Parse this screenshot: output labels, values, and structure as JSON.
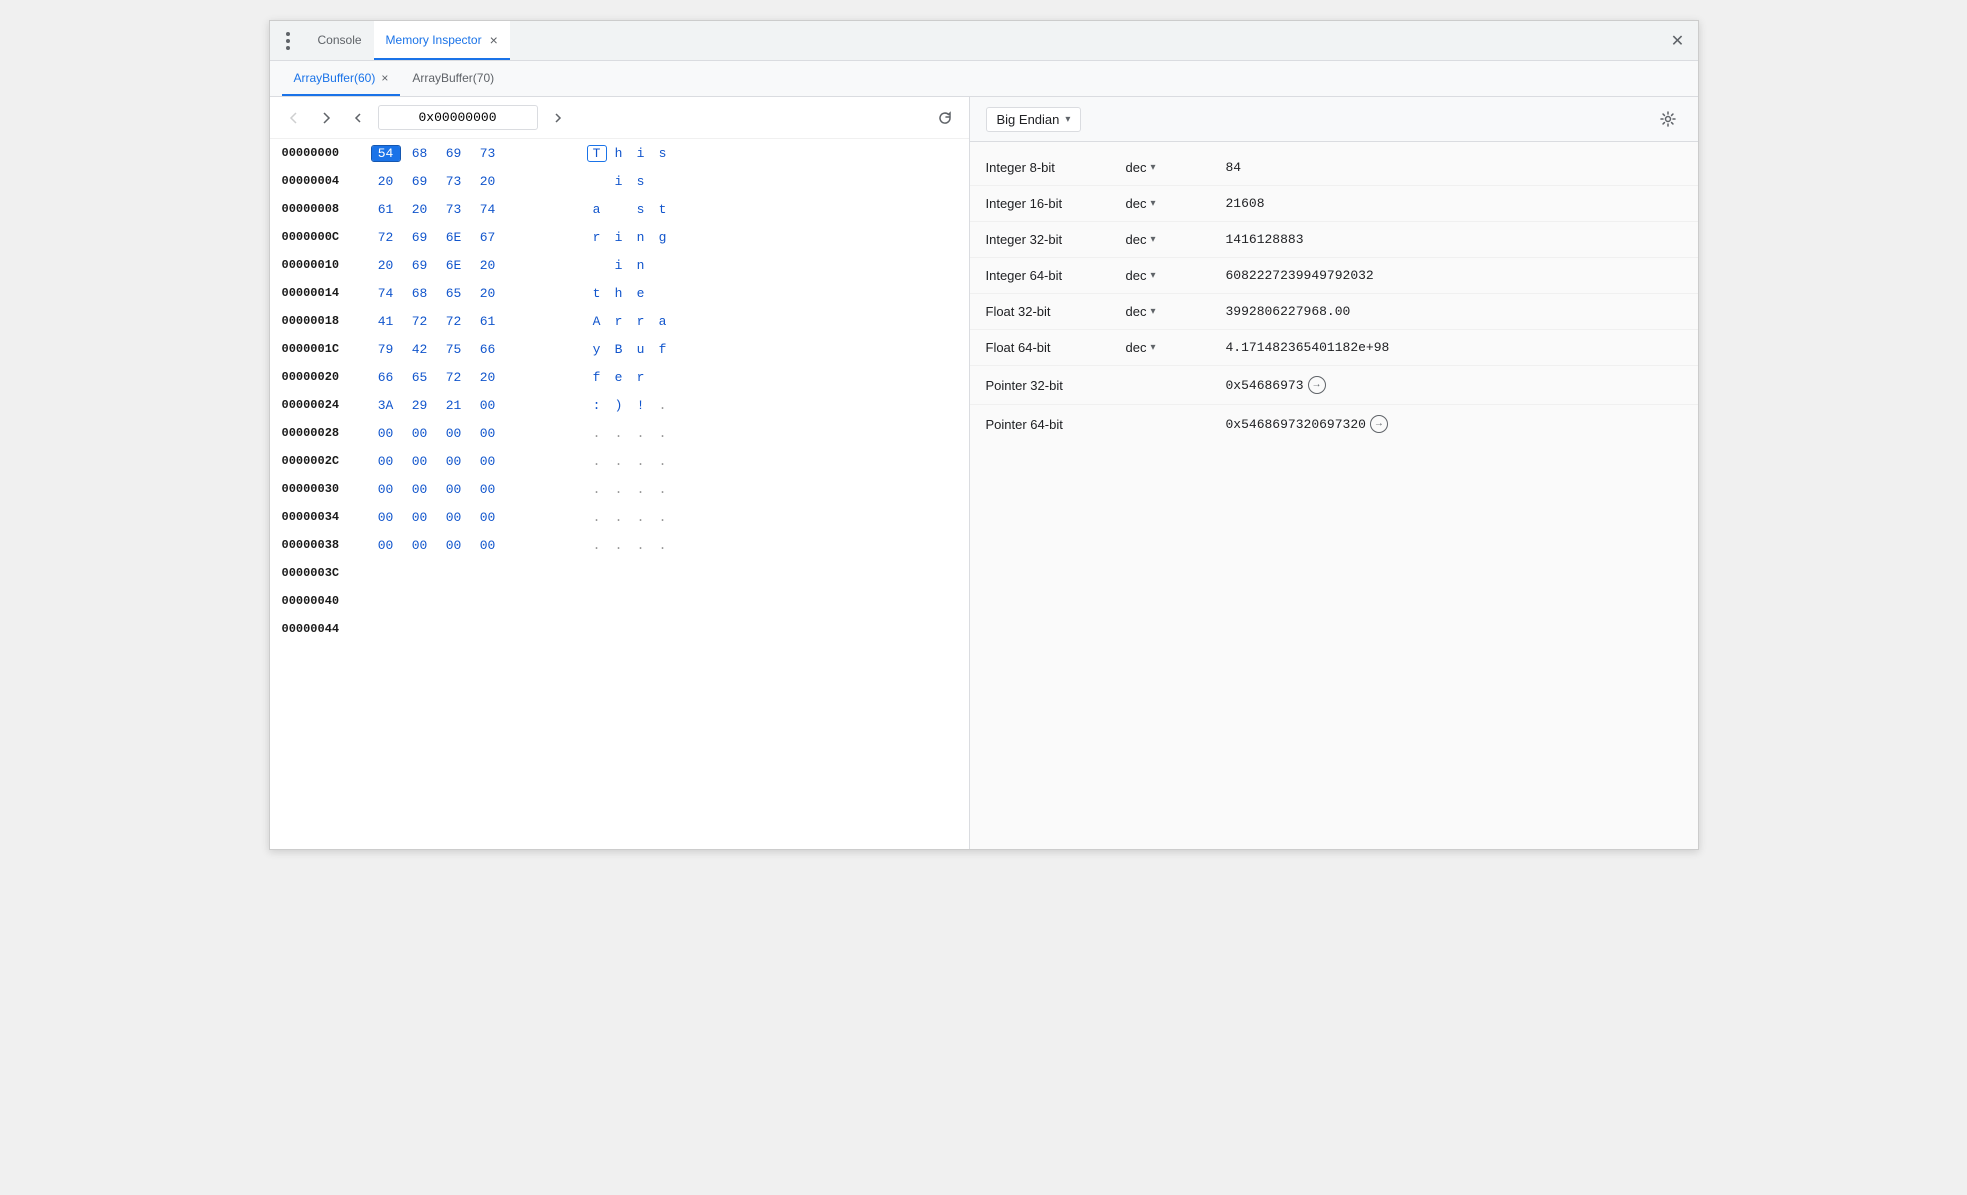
{
  "window": {
    "title": "Memory Inspector",
    "close_label": "✕"
  },
  "top_tabs": [
    {
      "id": "console",
      "label": "Console",
      "active": false,
      "closeable": false
    },
    {
      "id": "memory-inspector",
      "label": "Memory Inspector",
      "active": true,
      "closeable": true
    }
  ],
  "buffer_tabs": [
    {
      "id": "arraybuffer60",
      "label": "ArrayBuffer(60)",
      "active": true,
      "closeable": true
    },
    {
      "id": "arraybuffer70",
      "label": "ArrayBuffer(70)",
      "active": false,
      "closeable": false
    }
  ],
  "nav": {
    "back_label": "‹",
    "forward_label": "›",
    "address": "0x00000000",
    "refresh_label": "↻"
  },
  "memory_rows": [
    {
      "address": "00000000",
      "bytes": [
        "54",
        "68",
        "69",
        "73"
      ],
      "chars": [
        "T",
        "h",
        "i",
        "s"
      ],
      "selected_byte": 0,
      "highlighted_char": 0
    },
    {
      "address": "00000004",
      "bytes": [
        "20",
        "69",
        "73",
        "20"
      ],
      "chars": [
        " ",
        "i",
        "s",
        " "
      ]
    },
    {
      "address": "00000008",
      "bytes": [
        "61",
        "20",
        "73",
        "74"
      ],
      "chars": [
        "a",
        " ",
        "s",
        "t"
      ]
    },
    {
      "address": "0000000C",
      "bytes": [
        "72",
        "69",
        "6E",
        "67"
      ],
      "chars": [
        "r",
        "i",
        "n",
        "g"
      ]
    },
    {
      "address": "00000010",
      "bytes": [
        "20",
        "69",
        "6E",
        "20"
      ],
      "chars": [
        " ",
        "i",
        "n",
        " "
      ]
    },
    {
      "address": "00000014",
      "bytes": [
        "74",
        "68",
        "65",
        "20"
      ],
      "chars": [
        "t",
        "h",
        "e",
        " "
      ]
    },
    {
      "address": "00000018",
      "bytes": [
        "41",
        "72",
        "72",
        "61"
      ],
      "chars": [
        "A",
        "r",
        "r",
        "a"
      ]
    },
    {
      "address": "0000001C",
      "bytes": [
        "79",
        "42",
        "75",
        "66"
      ],
      "chars": [
        "y",
        "B",
        "u",
        "f"
      ]
    },
    {
      "address": "00000020",
      "bytes": [
        "66",
        "65",
        "72",
        "20"
      ],
      "chars": [
        "f",
        "e",
        "r",
        " "
      ]
    },
    {
      "address": "00000024",
      "bytes": [
        "3A",
        "29",
        "21",
        "00"
      ],
      "chars": [
        ":",
        ")",
        " ",
        "!"
      ]
    },
    {
      "address": "00000028",
      "bytes": [
        "00",
        "00",
        "00",
        "00"
      ],
      "chars": [
        ".",
        ".",
        ".",
        "."
      ]
    },
    {
      "address": "0000002C",
      "bytes": [
        "00",
        "00",
        "00",
        "00"
      ],
      "chars": [
        ".",
        ".",
        ".",
        "."
      ]
    },
    {
      "address": "00000030",
      "bytes": [
        "00",
        "00",
        "00",
        "00"
      ],
      "chars": [
        ".",
        ".",
        ".",
        "."
      ]
    },
    {
      "address": "00000034",
      "bytes": [
        "00",
        "00",
        "00",
        "00"
      ],
      "chars": [
        ".",
        ".",
        ".",
        "."
      ]
    },
    {
      "address": "00000038",
      "bytes": [
        "00",
        "00",
        "00",
        "00"
      ],
      "chars": [
        ".",
        ".",
        ".",
        "."
      ]
    },
    {
      "address": "0000003C",
      "bytes": [],
      "chars": []
    },
    {
      "address": "00000040",
      "bytes": [],
      "chars": []
    },
    {
      "address": "00000044",
      "bytes": [],
      "chars": []
    }
  ],
  "dot_rows": [
    10,
    11,
    12,
    13,
    14
  ],
  "inspector": {
    "endian": "Big Endian",
    "rows": [
      {
        "id": "int8",
        "label": "Integer 8-bit",
        "format": "dec",
        "has_caret": true,
        "value": "84",
        "is_pointer": false
      },
      {
        "id": "int16",
        "label": "Integer 16-bit",
        "format": "dec",
        "has_caret": true,
        "value": "21608",
        "is_pointer": false
      },
      {
        "id": "int32",
        "label": "Integer 32-bit",
        "format": "dec",
        "has_caret": true,
        "value": "1416128883",
        "is_pointer": false
      },
      {
        "id": "int64",
        "label": "Integer 64-bit",
        "format": "dec",
        "has_caret": true,
        "value": "6082227239949792032",
        "is_pointer": false
      },
      {
        "id": "float32",
        "label": "Float 32-bit",
        "format": "dec",
        "has_caret": true,
        "value": "3992806227968.00",
        "is_pointer": false
      },
      {
        "id": "float64",
        "label": "Float 64-bit",
        "format": "dec",
        "has_caret": true,
        "value": "4.17148236540118​2e+98",
        "is_pointer": false
      },
      {
        "id": "ptr32",
        "label": "Pointer 32-bit",
        "format": "",
        "has_caret": false,
        "value": "0x54686973",
        "is_pointer": true
      },
      {
        "id": "ptr64",
        "label": "Pointer 64-bit",
        "format": "",
        "has_caret": false,
        "value": "0x5468697320697320",
        "is_pointer": true
      }
    ]
  }
}
